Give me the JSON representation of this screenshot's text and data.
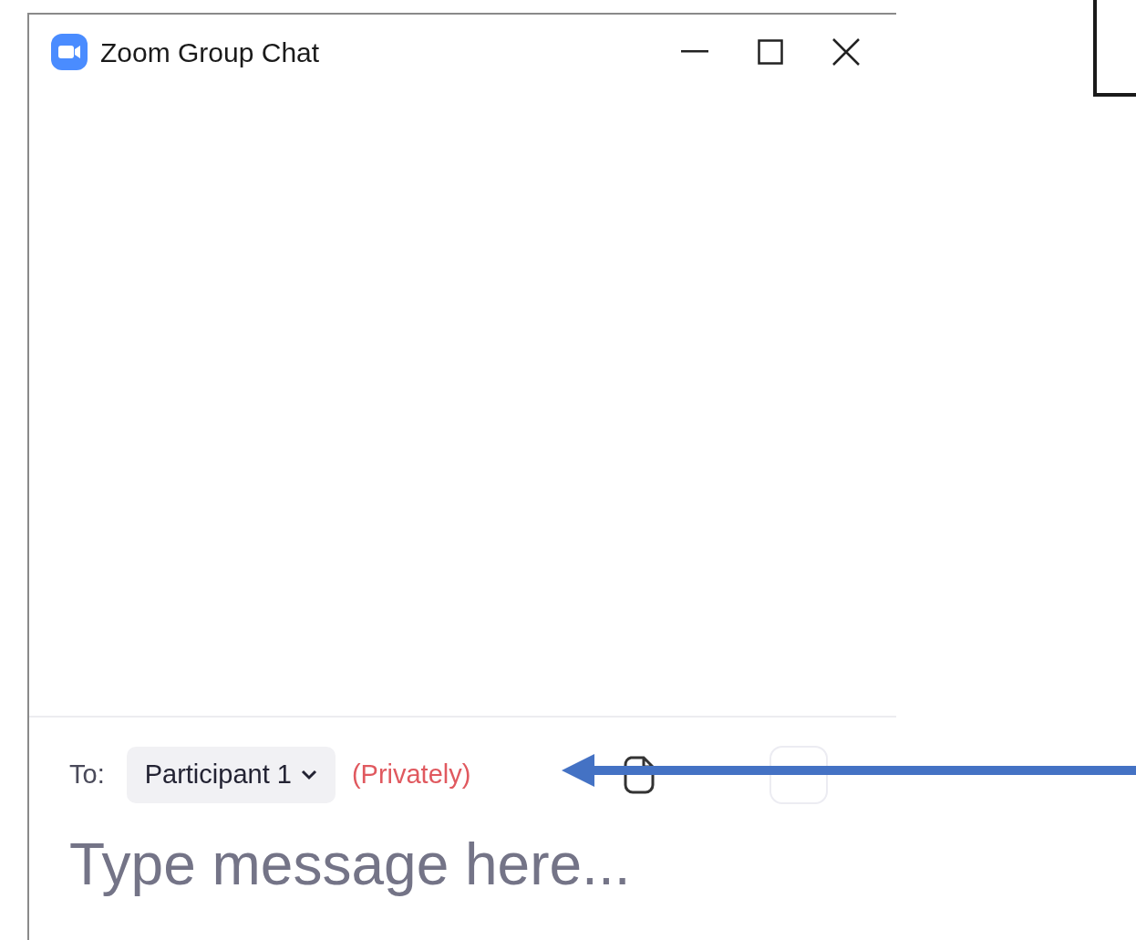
{
  "window": {
    "title": "Zoom Group Chat"
  },
  "composer": {
    "to_label": "To:",
    "recipient": "Participant 1",
    "privacy": "(Privately)",
    "placeholder": "Type message here..."
  }
}
